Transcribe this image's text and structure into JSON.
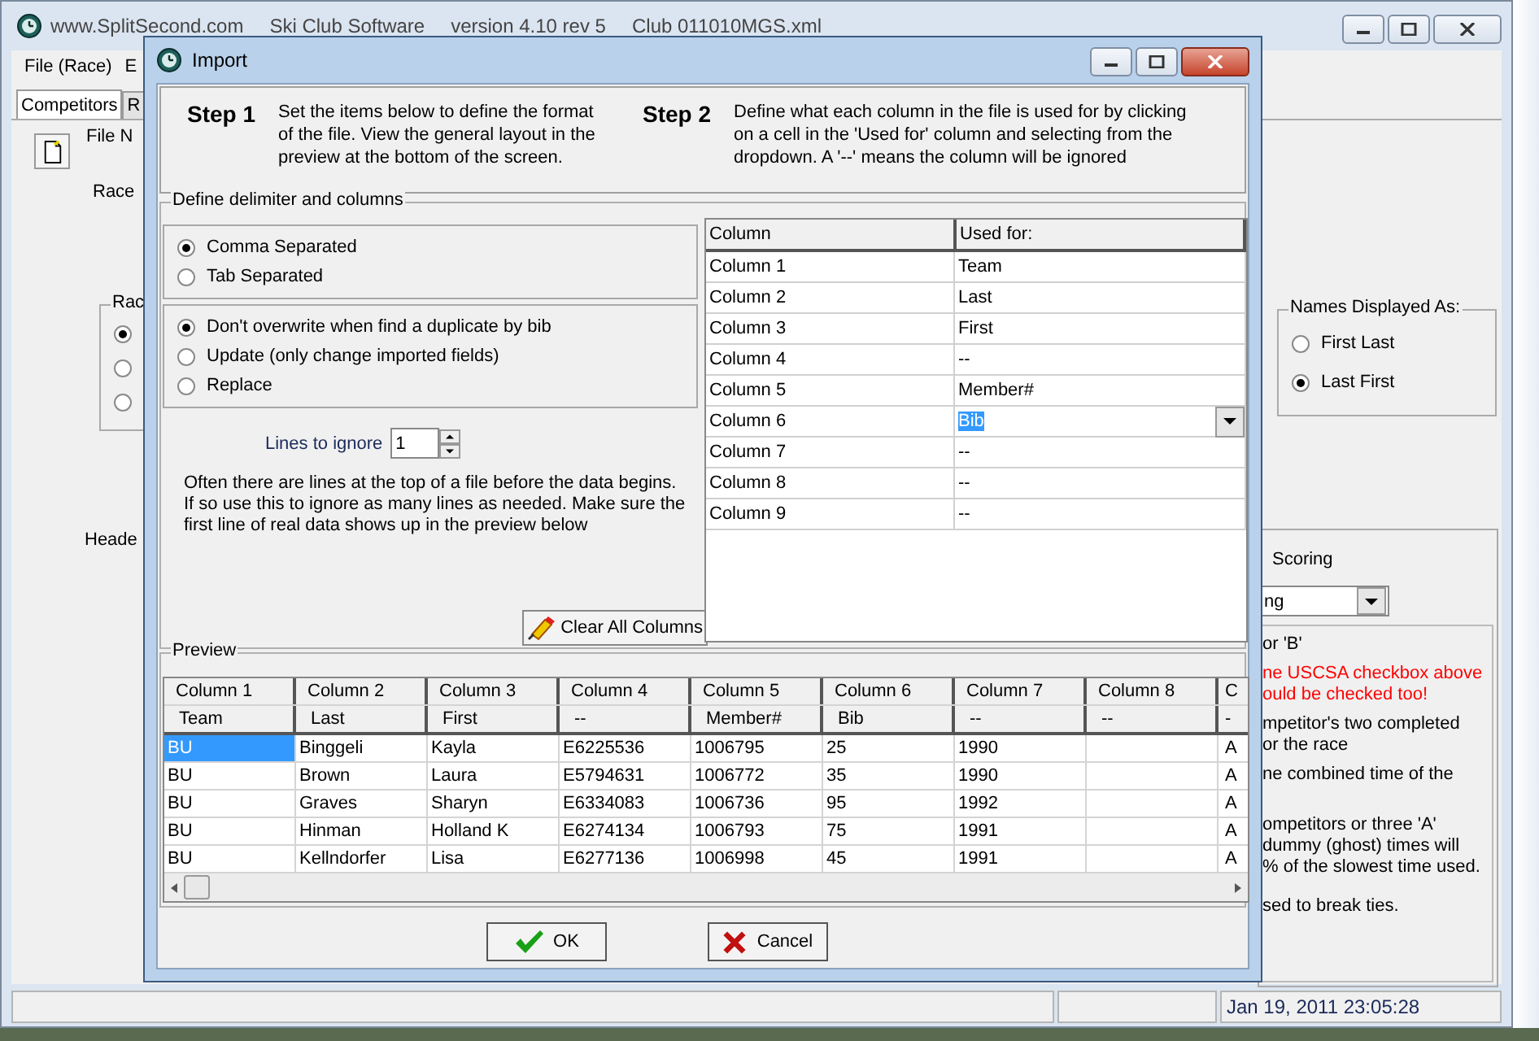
{
  "app_window": {
    "title_parts": [
      "www.SplitSecond.com",
      "Ski Club Software",
      "version 4.10 rev 5",
      "Club 011010MGS.xml"
    ],
    "menu": [
      "File (Race)",
      "E"
    ],
    "tabs": [
      {
        "label": "Competitors",
        "selected": true
      },
      {
        "label": "R",
        "selected": false
      }
    ],
    "labels": [
      "File N",
      "Race",
      "Heade"
    ],
    "race_group": {
      "legend": "Rac",
      "options": [
        {
          "selected": true
        },
        {
          "selected": false
        },
        {
          "selected": false
        }
      ]
    },
    "names_group": {
      "legend": "Names Displayed As:",
      "options": [
        {
          "label": "First Last",
          "selected": false
        },
        {
          "label": "Last First",
          "selected": true
        }
      ]
    },
    "scoring": {
      "label": "Scoring",
      "dropdown_value": "ng"
    },
    "notes": [
      {
        "text": "or 'B'",
        "kind": "normal"
      },
      {
        "text": "ne USCSA checkbox above\nould be checked too!",
        "kind": "warning"
      },
      {
        "text": "mpetitor's two completed\nor the race",
        "kind": "normal"
      },
      {
        "text": "ne combined time of the",
        "kind": "normal"
      },
      {
        "text": "ompetitors or three 'A'\ndummy (ghost) times will\n% of the slowest time used.",
        "kind": "normal"
      },
      {
        "text": "sed to break ties.",
        "kind": "normal"
      }
    ],
    "status_bar": "Jan 19, 2011   23:05:28"
  },
  "dialog": {
    "title": "Import",
    "steps": [
      {
        "label": "Step 1",
        "text": "Set the items below to define the format\nof the file. View the general layout in the\npreview at the bottom of the screen."
      },
      {
        "label": "Step 2",
        "text": "Define what each column in the file is used for by clicking\non a cell in the 'Used for' column and selecting from the\ndropdown. A '--' means the column will be ignored"
      }
    ],
    "delimiter_group": {
      "legend": "Define delimiter and columns",
      "delimiters": [
        {
          "label": "Comma Separated",
          "selected": true
        },
        {
          "label": "Tab Separated",
          "selected": false
        }
      ],
      "duplicates": [
        {
          "label": "Don't overwrite when find a duplicate by bib",
          "selected": true
        },
        {
          "label": "Update (only change imported fields)",
          "selected": false
        },
        {
          "label": "Replace",
          "selected": false
        }
      ],
      "lines_to_ignore": {
        "label": "Lines to ignore",
        "value": "1"
      },
      "help": "Often there are lines at the top of a file before the data begins.\nIf so use this to ignore as many lines as needed. Make sure the\nfirst line of real data shows up in the preview below",
      "clear_button": "Clear All Columns"
    },
    "column_grid": {
      "columns": [
        "Column",
        "Used for:"
      ],
      "rows": [
        {
          "column": "Column 1",
          "used_for": "Team",
          "editing": false
        },
        {
          "column": "Column 2",
          "used_for": "Last",
          "editing": false
        },
        {
          "column": "Column 3",
          "used_for": "First",
          "editing": false
        },
        {
          "column": "Column 4",
          "used_for": "--",
          "editing": false
        },
        {
          "column": "Column 5",
          "used_for": "Member#",
          "editing": false
        },
        {
          "column": "Column 6",
          "used_for": "Bib",
          "editing": true
        },
        {
          "column": "Column 7",
          "used_for": "--",
          "editing": false
        },
        {
          "column": "Column 8",
          "used_for": "--",
          "editing": false
        },
        {
          "column": "Column 9",
          "used_for": "--",
          "editing": false
        }
      ]
    },
    "preview": {
      "legend": "Preview",
      "columns": [
        {
          "header": "Column 1",
          "used_for": "Team"
        },
        {
          "header": "Column 2",
          "used_for": "Last"
        },
        {
          "header": "Column 3",
          "used_for": "First"
        },
        {
          "header": "Column 4",
          "used_for": "--"
        },
        {
          "header": "Column 5",
          "used_for": "Member#"
        },
        {
          "header": "Column 6",
          "used_for": "Bib"
        },
        {
          "header": "Column 7",
          "used_for": "--"
        },
        {
          "header": "Column 8",
          "used_for": "--"
        },
        {
          "header": "C",
          "used_for": "-"
        }
      ],
      "rows": [
        {
          "selected": true,
          "cells": [
            "BU",
            "Binggeli",
            "Kayla",
            "E6225536",
            "1006795",
            "25",
            "1990",
            null,
            "A"
          ]
        },
        {
          "selected": false,
          "cells": [
            "BU",
            "Brown",
            "Laura",
            "E5794631",
            "1006772",
            "35",
            "1990",
            null,
            "A"
          ]
        },
        {
          "selected": false,
          "cells": [
            "BU",
            "Graves",
            "Sharyn",
            "E6334083",
            "1006736",
            "95",
            "1992",
            null,
            "A"
          ]
        },
        {
          "selected": false,
          "cells": [
            "BU",
            "Hinman",
            "Holland K",
            "E6274134",
            "1006793",
            "75",
            "1991",
            null,
            "A"
          ]
        },
        {
          "selected": false,
          "cells": [
            "BU",
            "Kellndorfer",
            "Lisa",
            "E6277136",
            "1006998",
            "45",
            "1991",
            null,
            "A"
          ]
        }
      ]
    },
    "buttons": [
      {
        "label": "OK",
        "kind": "ok"
      },
      {
        "label": "Cancel",
        "kind": "cancel"
      }
    ]
  }
}
